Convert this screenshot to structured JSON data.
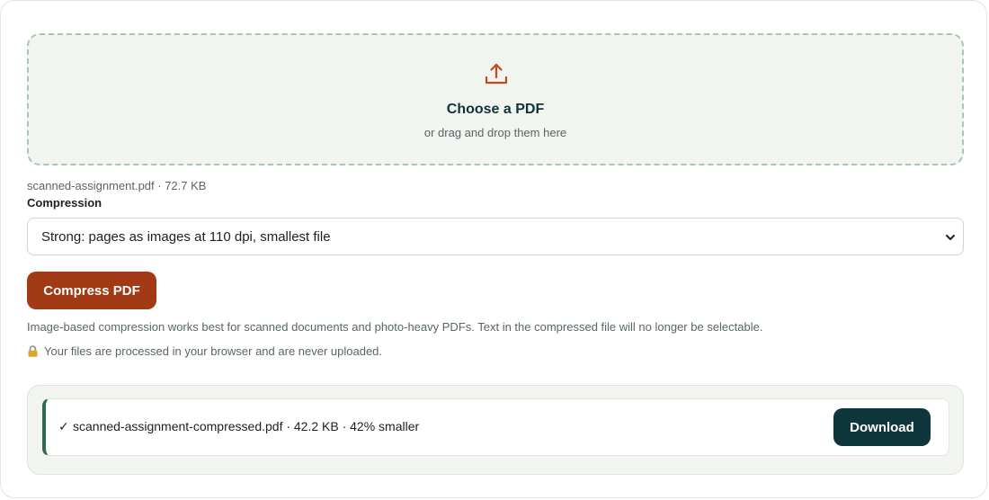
{
  "dropzone": {
    "title": "Choose a PDF",
    "subtitle": "or drag and drop them here",
    "icon": "upload-icon"
  },
  "file": {
    "meta": "scanned-assignment.pdf · 72.7 KB"
  },
  "compression": {
    "label": "Compression",
    "selected": "Strong: pages as images at 110 dpi, smallest file"
  },
  "actions": {
    "compress_label": "Compress PDF"
  },
  "notes": {
    "image_based": "Image-based compression works best for scanned documents and photo-heavy PDFs. Text in the compressed file will no longer be selectable.",
    "privacy": "Your files are processed in your browser and are never uploaded."
  },
  "result": {
    "check": "✓",
    "text": "scanned-assignment-compressed.pdf · 42.2 KB · 42% smaller",
    "download_label": "Download"
  },
  "colors": {
    "accent_orange": "#a33a16",
    "dark_teal": "#0f363c",
    "success_green": "#2f6b4f",
    "dropzone_bg": "#f2f4f0"
  }
}
